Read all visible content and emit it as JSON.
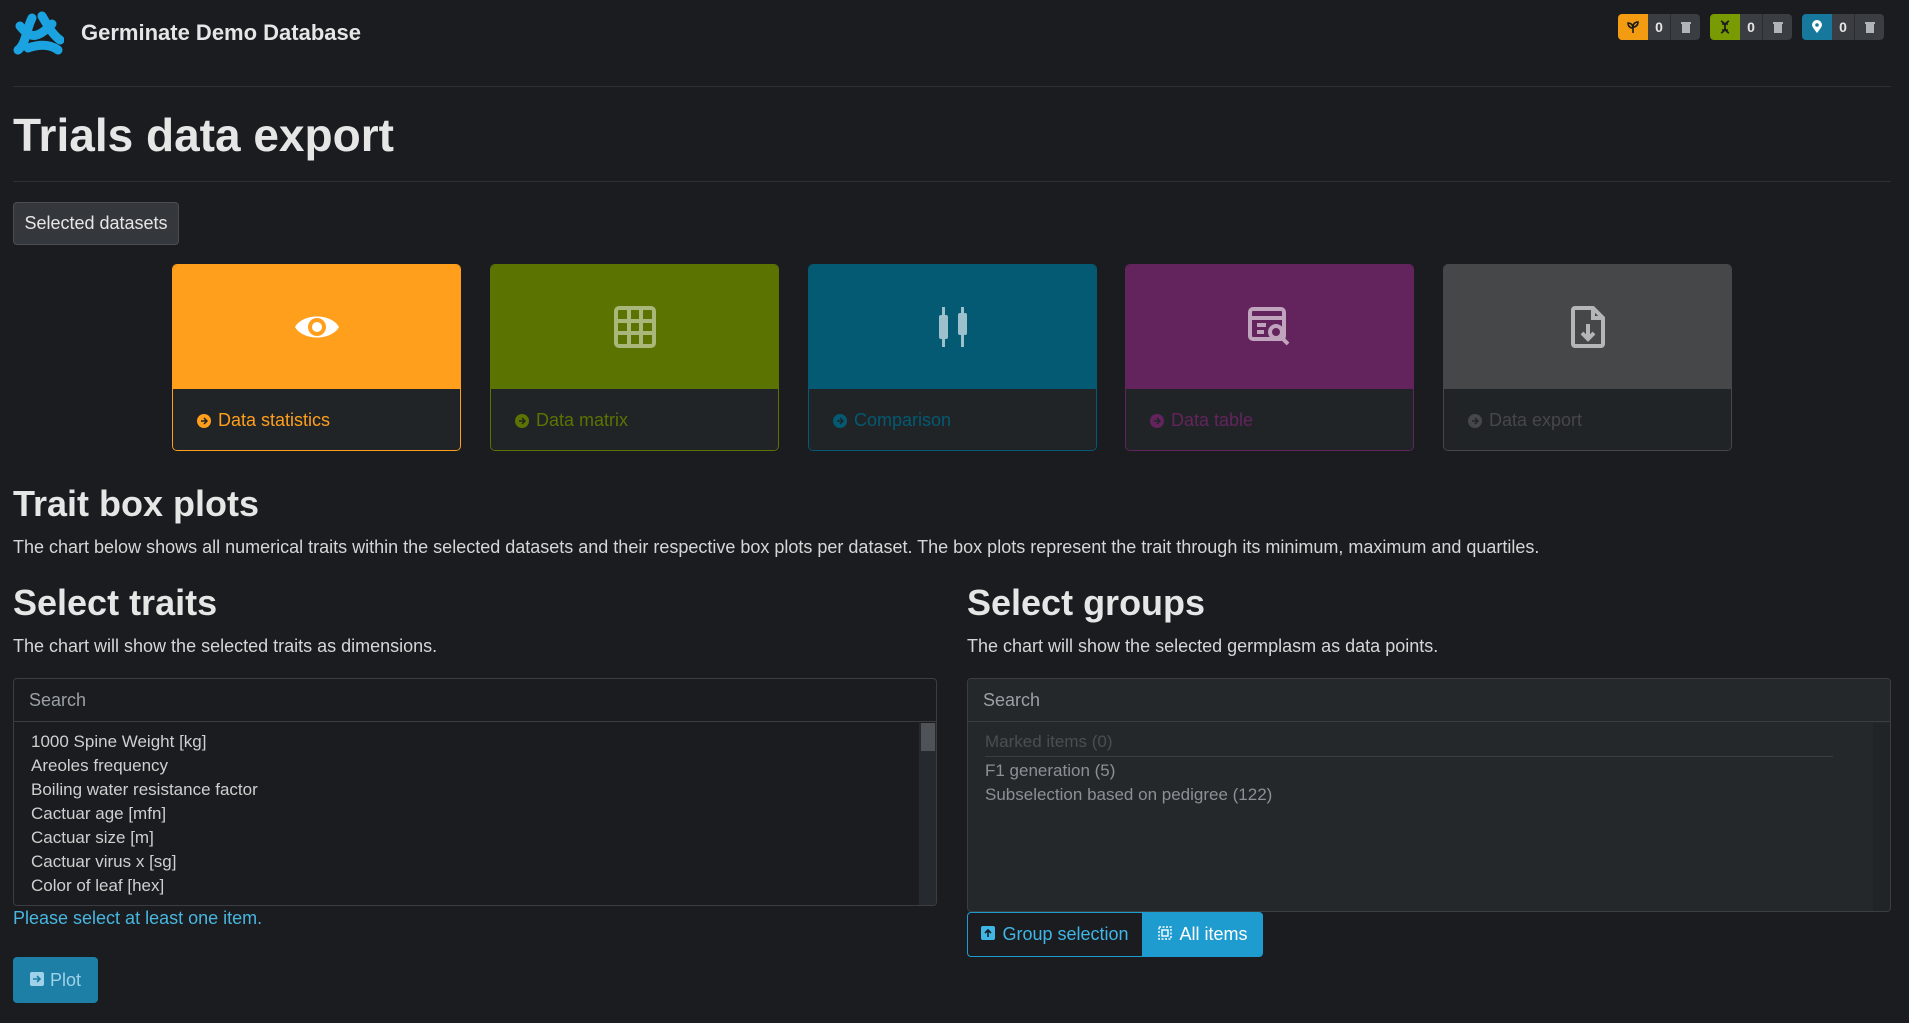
{
  "header": {
    "app_name": "Germinate Demo Database",
    "badges": [
      {
        "name": "germplasm",
        "count": "0",
        "color": "#f39c12"
      },
      {
        "name": "markers",
        "count": "0",
        "color": "#7a9a01"
      },
      {
        "name": "locations",
        "count": "0",
        "color": "#16799c"
      }
    ]
  },
  "page": {
    "title": "Trials data export",
    "selected_datasets_label": "Selected datasets"
  },
  "nav_cards": [
    {
      "label": "Data statistics",
      "icon": "eye-icon",
      "color": "#ff9f1c",
      "active": true
    },
    {
      "label": "Data matrix",
      "icon": "grid-icon",
      "color": "#5b7301"
    },
    {
      "label": "Comparison",
      "icon": "compare-icon",
      "color": "#035a72"
    },
    {
      "label": "Data table",
      "icon": "table-search-icon",
      "color": "#63245d"
    },
    {
      "label": "Data export",
      "icon": "file-download-icon",
      "color": "#454749"
    }
  ],
  "boxplots": {
    "title": "Trait box plots",
    "description": "The chart below shows all numerical traits within the selected datasets and their respective box plots per dataset. The box plots represent the trait through its minimum, maximum and quartiles."
  },
  "traits": {
    "title": "Select traits",
    "description": "The chart will show the selected traits as dimensions.",
    "search_placeholder": "Search",
    "items": [
      "1000 Spine Weight [kg]",
      "Areoles frequency",
      "Boiling water resistance factor",
      "Cactuar age [mfn]",
      "Cactuar size [m]",
      "Cactuar virus x [sg]",
      "Color of leaf [hex]"
    ],
    "help_text": "Please select at least one item.",
    "plot_label": "Plot"
  },
  "groups": {
    "title": "Select groups",
    "description": "The chart will show the selected germplasm as data points.",
    "search_placeholder": "Search",
    "items": [
      "Marked items (0)",
      "F1 generation (5)",
      "Subselection based on pedigree (122)"
    ],
    "toggle_group": "Group selection",
    "toggle_all": "All items"
  }
}
